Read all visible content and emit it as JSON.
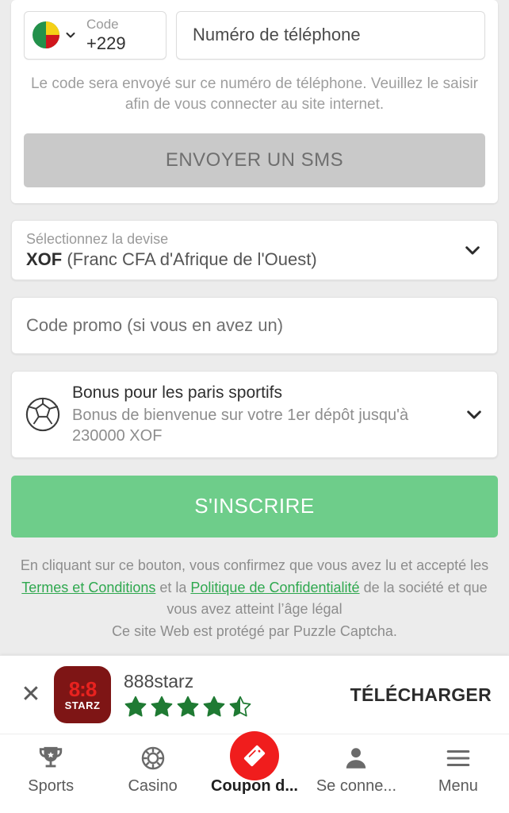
{
  "page": {
    "background": "#ececec",
    "accent_green": "#6ecd8a",
    "link_green": "#2fa84f",
    "accent_red": "#f01d1d"
  },
  "phone": {
    "country_flag": "benin-flag-icon",
    "code_label": "Code",
    "code_value": "+229",
    "placeholder": "Numéro de téléphone",
    "value": "",
    "hint": "Le code sera envoyé sur ce numéro de téléphone. Veuillez le saisir afin de vous connecter au site internet.",
    "send_sms_label": "ENVOYER UN SMS"
  },
  "currency": {
    "label": "Sélectionnez la devise",
    "code": "XOF",
    "name": "(Franc CFA d'Afrique de l'Ouest)"
  },
  "promo": {
    "placeholder": "Code promo (si vous en avez un)",
    "value": ""
  },
  "bonus": {
    "title": "Bonus pour les paris sportifs",
    "subtitle": "Bonus de bienvenue sur votre 1er dépôt jusqu'à 230000 XOF"
  },
  "register": {
    "label": "S'INSCRIRE"
  },
  "legal": {
    "part1": "En cliquant sur ce bouton, vous confirmez que vous avez lu et accepté les ",
    "terms_link": "Termes et Conditions",
    "part2": " et la ",
    "privacy_link": "Politique de Confidentialité",
    "part3": " de la société et que vous avez atteint l’âge légal",
    "captcha": "Ce site Web est protégé par Puzzle Captcha."
  },
  "app_banner": {
    "close_icon": "close-icon",
    "logo_top": "8:8",
    "logo_bottom": "STARZ",
    "app_name": "888starz",
    "rating": 4.5,
    "stars_total": 5,
    "download_label": "TÉLÉCHARGER"
  },
  "bottom_nav": {
    "items": [
      {
        "label": "Sports",
        "icon": "trophy-icon",
        "featured": false
      },
      {
        "label": "Casino",
        "icon": "casino-chip-icon",
        "featured": false
      },
      {
        "label": "Coupon d...",
        "icon": "coupon-ticket-icon",
        "featured": true
      },
      {
        "label": "Se conne...",
        "icon": "user-icon",
        "featured": false
      },
      {
        "label": "Menu",
        "icon": "hamburger-menu-icon",
        "featured": false
      }
    ]
  }
}
